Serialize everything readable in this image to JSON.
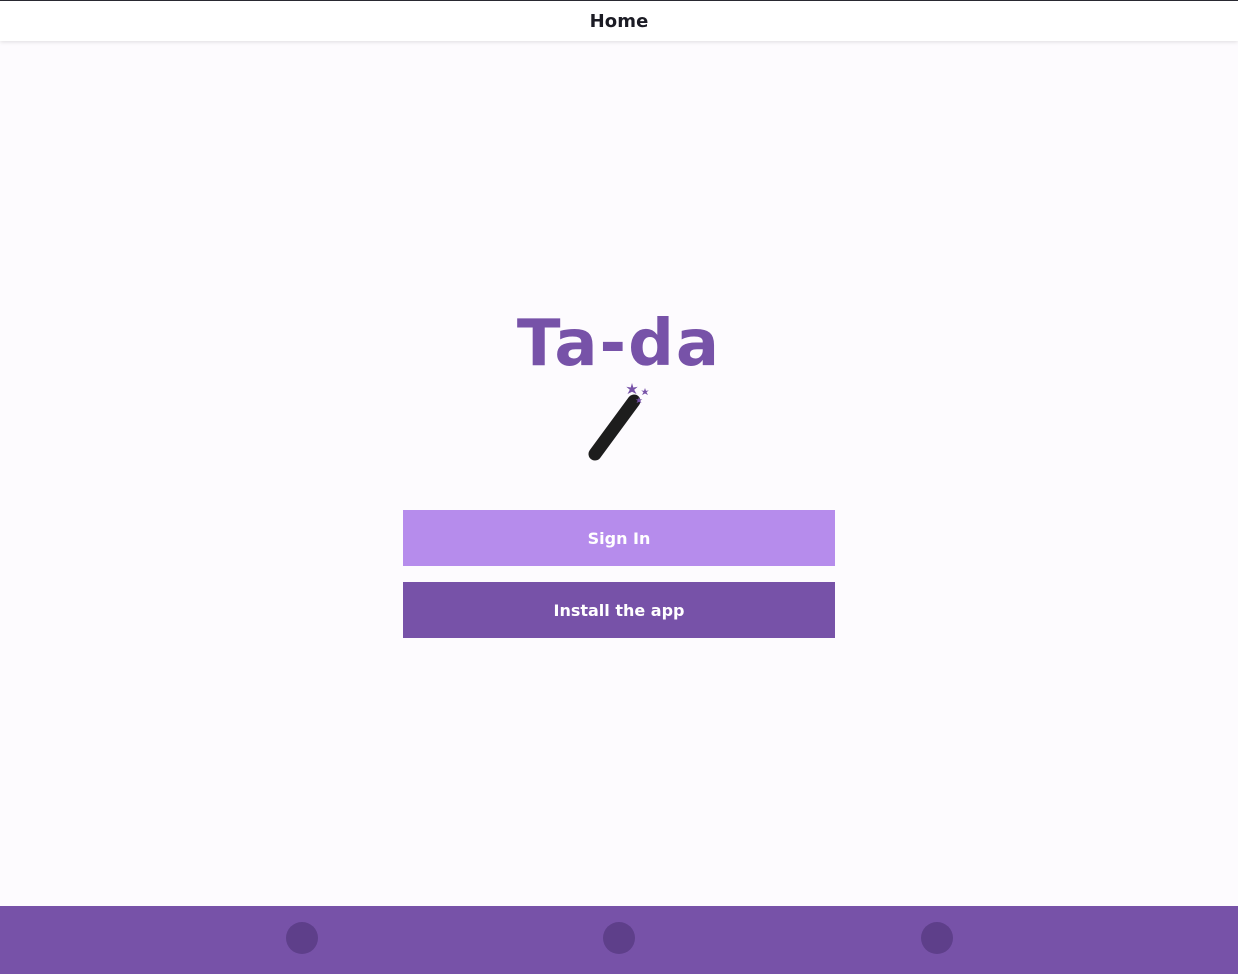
{
  "header": {
    "title": "Home"
  },
  "app": {
    "title": "Ta-da",
    "logo_icon": "magic-wand-icon"
  },
  "actions": {
    "sign_in_label": "Sign In",
    "install_label": "Install the app"
  },
  "bottom_nav": {
    "items": [
      {
        "icon": "nav-icon-1"
      },
      {
        "icon": "nav-icon-2"
      },
      {
        "icon": "nav-icon-3"
      }
    ]
  },
  "colors": {
    "primary": "#7752a8",
    "primary_light": "#b68cec",
    "nav_dot": "#5e3f8a",
    "background": "#fdfbfe",
    "header_text": "#1b1b24"
  }
}
